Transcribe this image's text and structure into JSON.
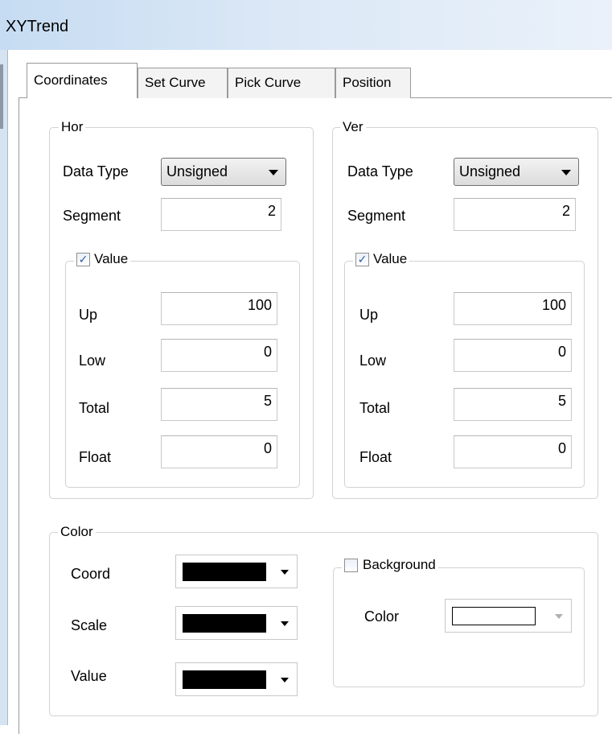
{
  "window": {
    "title": "XYTrend"
  },
  "tabs": [
    {
      "label": "Coordinates",
      "active": true
    },
    {
      "label": "Set Curve",
      "active": false
    },
    {
      "label": "Pick Curve",
      "active": false
    },
    {
      "label": "Position",
      "active": false
    }
  ],
  "hor": {
    "legend": "Hor",
    "data_type_label": "Data Type",
    "data_type_value": "Unsigned",
    "segment_label": "Segment",
    "segment_value": "2",
    "value_group": {
      "label": "Value",
      "checked": true,
      "up_label": "Up",
      "up_value": "100",
      "low_label": "Low",
      "low_value": "0",
      "total_label": "Total",
      "total_value": "5",
      "float_label": "Float",
      "float_value": "0"
    }
  },
  "ver": {
    "legend": "Ver",
    "data_type_label": "Data Type",
    "data_type_value": "Unsigned",
    "segment_label": "Segment",
    "segment_value": "2",
    "value_group": {
      "label": "Value",
      "checked": true,
      "up_label": "Up",
      "up_value": "100",
      "low_label": "Low",
      "low_value": "0",
      "total_label": "Total",
      "total_value": "5",
      "float_label": "Float",
      "float_value": "0"
    }
  },
  "color": {
    "legend": "Color",
    "coord_label": "Coord",
    "coord_color": "#000000",
    "scale_label": "Scale",
    "scale_color": "#000000",
    "value_label": "Value",
    "value_color": "#000000",
    "background": {
      "label": "Background",
      "checked": false,
      "color_label": "Color",
      "color": "#ffffff"
    }
  },
  "colors": {
    "title_bar": "#d4e4f5",
    "check_mark": "#2c5a9c"
  }
}
